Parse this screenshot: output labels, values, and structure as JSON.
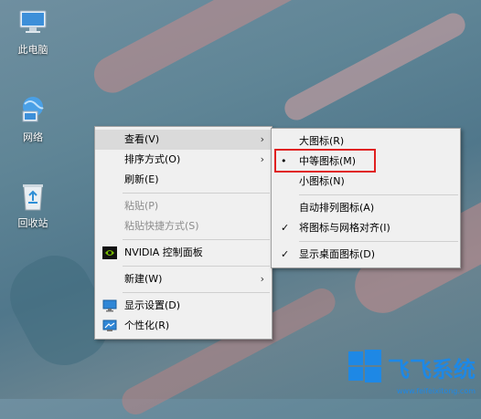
{
  "desktop_icons": [
    {
      "label": "此电脑",
      "icon": "computer-icon"
    },
    {
      "label": "网络",
      "icon": "network-icon"
    },
    {
      "label": "回收站",
      "icon": "recycle-bin-icon"
    }
  ],
  "context_menu": {
    "items": [
      {
        "label": "查看(V)",
        "submenu": true,
        "highlighted": true
      },
      {
        "label": "排序方式(O)",
        "submenu": true
      },
      {
        "label": "刷新(E)"
      },
      {
        "label": "粘贴(P)",
        "disabled": true
      },
      {
        "label": "粘贴快捷方式(S)",
        "disabled": true
      },
      {
        "label": "NVIDIA 控制面板",
        "icon": "nvidia-icon"
      },
      {
        "label": "新建(W)",
        "submenu": true
      },
      {
        "label": "显示设置(D)",
        "icon": "display-icon"
      },
      {
        "label": "个性化(R)",
        "icon": "personalize-icon"
      }
    ]
  },
  "view_submenu": {
    "items": [
      {
        "label": "大图标(R)"
      },
      {
        "label": "中等图标(M)",
        "mark": "•",
        "selected": true
      },
      {
        "label": "小图标(N)"
      },
      {
        "label": "自动排列图标(A)"
      },
      {
        "label": "将图标与网格对齐(I)",
        "mark": "✓"
      },
      {
        "label": "显示桌面图标(D)",
        "mark": "✓"
      }
    ]
  },
  "watermark": {
    "title": "飞飞系统",
    "url": "www.feifeixitong.com"
  },
  "colors": {
    "highlight_box": "#e02020",
    "brand_blue": "#1e88e5"
  }
}
